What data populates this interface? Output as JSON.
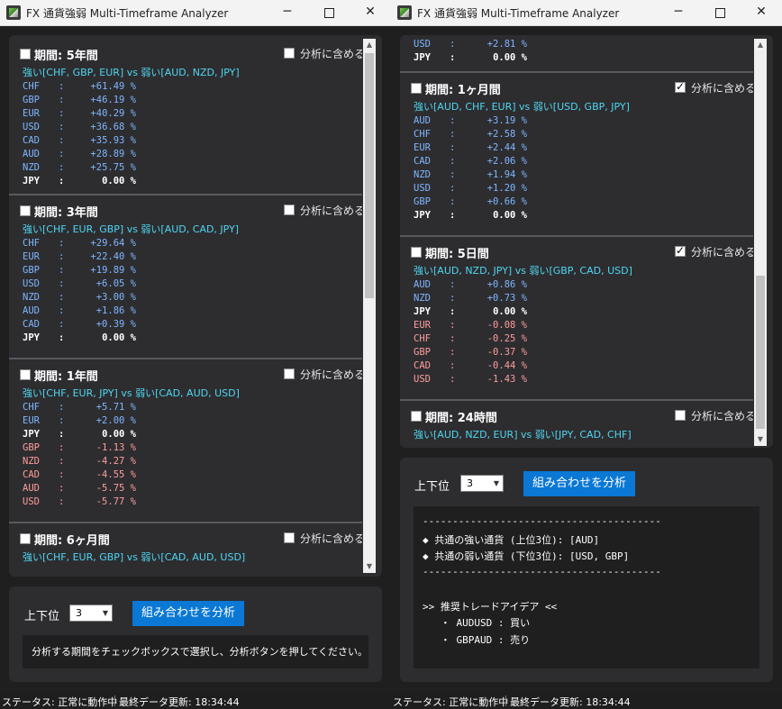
{
  "window": {
    "title": "FX 通貨強弱 Multi-Timeframe Analyzer",
    "include_label": "分析に含める"
  },
  "left": {
    "sections": [
      {
        "title": "期間: 5年間",
        "include": false,
        "summary": "強い[CHF, GBP, EUR] vs 弱い[AUD, NZD, JPY]",
        "rows": [
          {
            "cur": "CHF",
            "val": "+61.49 %",
            "sign": "pos"
          },
          {
            "cur": "GBP",
            "val": "+46.19 %",
            "sign": "pos"
          },
          {
            "cur": "EUR",
            "val": "+40.29 %",
            "sign": "pos"
          },
          {
            "cur": "USD",
            "val": "+36.68 %",
            "sign": "pos"
          },
          {
            "cur": "CAD",
            "val": "+35.93 %",
            "sign": "pos"
          },
          {
            "cur": "AUD",
            "val": "+28.89 %",
            "sign": "pos"
          },
          {
            "cur": "NZD",
            "val": "+25.75 %",
            "sign": "pos"
          },
          {
            "cur": "JPY",
            "val": "0.00 %",
            "sign": "zero"
          }
        ]
      },
      {
        "title": "期間: 3年間",
        "include": false,
        "summary": "強い[CHF, EUR, GBP] vs 弱い[AUD, CAD, JPY]",
        "rows": [
          {
            "cur": "CHF",
            "val": "+29.64 %",
            "sign": "pos"
          },
          {
            "cur": "EUR",
            "val": "+22.40 %",
            "sign": "pos"
          },
          {
            "cur": "GBP",
            "val": "+19.89 %",
            "sign": "pos"
          },
          {
            "cur": "USD",
            "val": "+6.05 %",
            "sign": "pos"
          },
          {
            "cur": "NZD",
            "val": "+3.00 %",
            "sign": "pos"
          },
          {
            "cur": "AUD",
            "val": "+1.86 %",
            "sign": "pos"
          },
          {
            "cur": "CAD",
            "val": "+0.39 %",
            "sign": "pos"
          },
          {
            "cur": "JPY",
            "val": "0.00 %",
            "sign": "zero"
          }
        ]
      },
      {
        "title": "期間: 1年間",
        "include": false,
        "summary": "強い[CHF, EUR, JPY] vs 弱い[CAD, AUD, USD]",
        "rows": [
          {
            "cur": "CHF",
            "val": "+5.71 %",
            "sign": "pos"
          },
          {
            "cur": "EUR",
            "val": "+2.00 %",
            "sign": "pos"
          },
          {
            "cur": "JPY",
            "val": "0.00 %",
            "sign": "zero"
          },
          {
            "cur": "GBP",
            "val": "-1.13 %",
            "sign": "neg"
          },
          {
            "cur": "NZD",
            "val": "-4.27 %",
            "sign": "neg"
          },
          {
            "cur": "CAD",
            "val": "-4.55 %",
            "sign": "neg"
          },
          {
            "cur": "AUD",
            "val": "-5.75 %",
            "sign": "neg"
          },
          {
            "cur": "USD",
            "val": "-5.77 %",
            "sign": "neg"
          }
        ]
      },
      {
        "title": "期間: 6ヶ月間",
        "include": false,
        "summary": "強い[CHF, EUR, GBP] vs 弱い[CAD, AUD, USD]",
        "rows": []
      }
    ],
    "controls": {
      "top_label": "上下位",
      "top_value": "3",
      "analyze_label": "組み合わせを分析"
    },
    "output_lines": [
      "分析する期間をチェックボックスで選択し、分析ボタンを押してください。"
    ]
  },
  "right": {
    "pre_rows": [
      {
        "cur": "USD",
        "val": "+2.81 %",
        "sign": "pos"
      },
      {
        "cur": "JPY",
        "val": "0.00 %",
        "sign": "zero"
      }
    ],
    "sections": [
      {
        "title": "期間: 1ヶ月間",
        "include": true,
        "summary": "強い[AUD, CHF, EUR] vs 弱い[USD, GBP, JPY]",
        "rows": [
          {
            "cur": "AUD",
            "val": "+3.19 %",
            "sign": "pos"
          },
          {
            "cur": "CHF",
            "val": "+2.58 %",
            "sign": "pos"
          },
          {
            "cur": "EUR",
            "val": "+2.44 %",
            "sign": "pos"
          },
          {
            "cur": "CAD",
            "val": "+2.06 %",
            "sign": "pos"
          },
          {
            "cur": "NZD",
            "val": "+1.94 %",
            "sign": "pos"
          },
          {
            "cur": "USD",
            "val": "+1.20 %",
            "sign": "pos"
          },
          {
            "cur": "GBP",
            "val": "+0.66 %",
            "sign": "pos"
          },
          {
            "cur": "JPY",
            "val": "0.00 %",
            "sign": "zero"
          }
        ]
      },
      {
        "title": "期間: 5日間",
        "include": true,
        "summary": "強い[AUD, NZD, JPY] vs 弱い[GBP, CAD, USD]",
        "rows": [
          {
            "cur": "AUD",
            "val": "+0.86 %",
            "sign": "pos"
          },
          {
            "cur": "NZD",
            "val": "+0.73 %",
            "sign": "pos"
          },
          {
            "cur": "JPY",
            "val": "0.00 %",
            "sign": "zero"
          },
          {
            "cur": "EUR",
            "val": "-0.08 %",
            "sign": "neg"
          },
          {
            "cur": "CHF",
            "val": "-0.25 %",
            "sign": "neg"
          },
          {
            "cur": "GBP",
            "val": "-0.37 %",
            "sign": "neg"
          },
          {
            "cur": "CAD",
            "val": "-0.44 %",
            "sign": "neg"
          },
          {
            "cur": "USD",
            "val": "-1.43 %",
            "sign": "neg"
          }
        ]
      },
      {
        "title": "期間: 24時間",
        "include": false,
        "summary": "強い[AUD, NZD, EUR] vs 弱い[JPY, CAD, CHF]",
        "rows": []
      }
    ],
    "controls": {
      "top_label": "上下位",
      "top_value": "3",
      "analyze_label": "組み合わせを分析"
    },
    "output_lines": [
      "----------------------------------------",
      "◆ 共通の強い通貨 (上位3位): [AUD]",
      "◆ 共通の弱い通貨 (下位3位): [USD, GBP]",
      "----------------------------------------",
      "",
      ">> 推奨トレードアイデア <<",
      "   ・ AUDUSD : 買い",
      "   ・ GBPAUD : 売り"
    ]
  },
  "status": {
    "text": "ステータス: 正常に動作中",
    "updated": "最終データ更新: 18:34:44"
  },
  "colors": {
    "positive": "#7fb6ff",
    "negative": "#ff9c9c",
    "summary": "#4fd6f0",
    "button": "#0a78d4"
  }
}
